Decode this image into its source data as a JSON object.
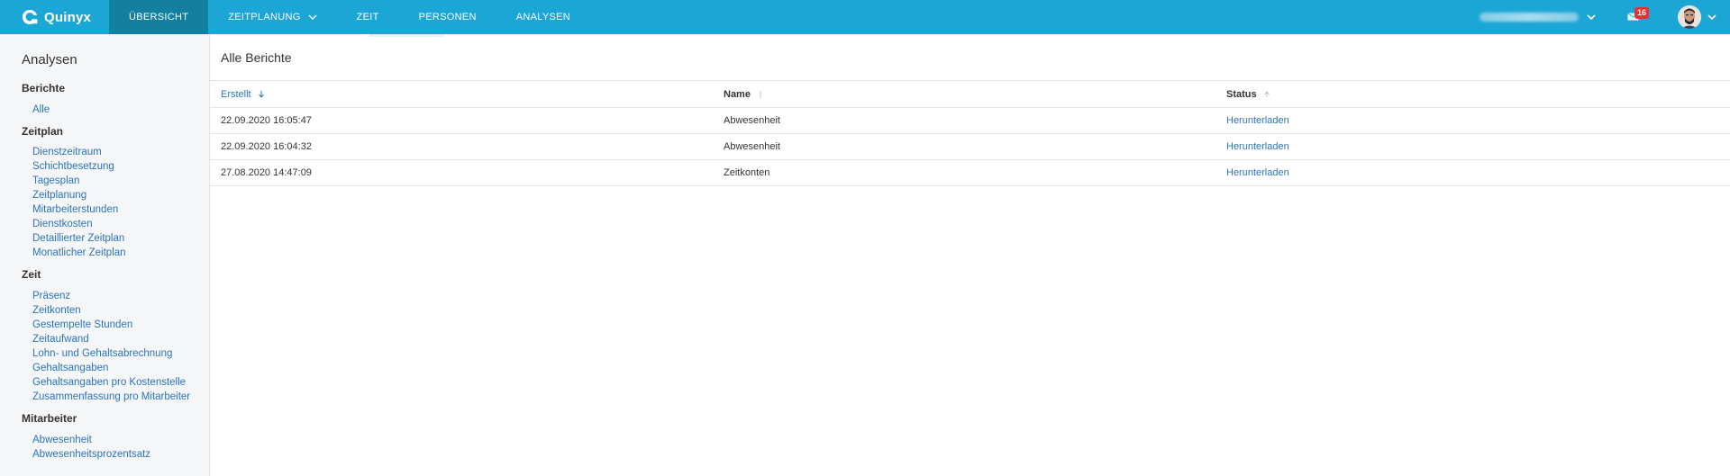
{
  "brand": {
    "name": "Quinyx"
  },
  "nav": {
    "items": [
      {
        "label": "ÜBERSICHT",
        "active": true
      },
      {
        "label": "ZEITPLANUNG",
        "dropdown": true
      },
      {
        "label": "ZEIT"
      },
      {
        "label": "PERSONEN"
      },
      {
        "label": "ANALYSEN"
      }
    ]
  },
  "header": {
    "notifications_count": "16",
    "icons": [
      "chevron-down-icon",
      "mail-icon",
      "avatar"
    ]
  },
  "sidebar": {
    "title": "Analysen",
    "groups": [
      {
        "label": "Berichte",
        "items": [
          "Alle"
        ]
      },
      {
        "label": "Zeitplan",
        "items": [
          "Dienstzeitraum",
          "Schichtbesetzung",
          "Tagesplan",
          "Zeitplanung",
          "Mitarbeiterstunden",
          "Dienstkosten",
          "Detaillierter Zeitplan",
          "Monatlicher Zeitplan"
        ]
      },
      {
        "label": "Zeit",
        "items": [
          "Präsenz",
          "Zeitkonten",
          "Gestempelte Stunden",
          "Zeitaufwand",
          "Lohn- und Gehaltsabrechnung",
          "Gehaltsangaben",
          "Gehaltsangaben pro Kostenstelle",
          "Zusammenfassung pro Mitarbeiter"
        ]
      },
      {
        "label": "Mitarbeiter",
        "items": [
          "Abwesenheit",
          "Abwesenheitsprozentsatz"
        ]
      }
    ]
  },
  "main": {
    "title": "Alle Berichte",
    "columns": [
      "Erstellt",
      "Name",
      "Status"
    ],
    "rows": [
      {
        "created": "22.09.2020 16:05:47",
        "name": "Abwesenheit",
        "status": "Herunterladen"
      },
      {
        "created": "22.09.2020 16:04:32",
        "name": "Abwesenheit",
        "status": "Herunterladen"
      },
      {
        "created": "27.08.2020 14:47:09",
        "name": "Zeitkonten",
        "status": "Herunterladen"
      }
    ]
  },
  "colors": {
    "topbar": "#1ba6d6",
    "nav_active": "#14809f",
    "link": "#2a73bd",
    "badge": "#e8302e"
  }
}
